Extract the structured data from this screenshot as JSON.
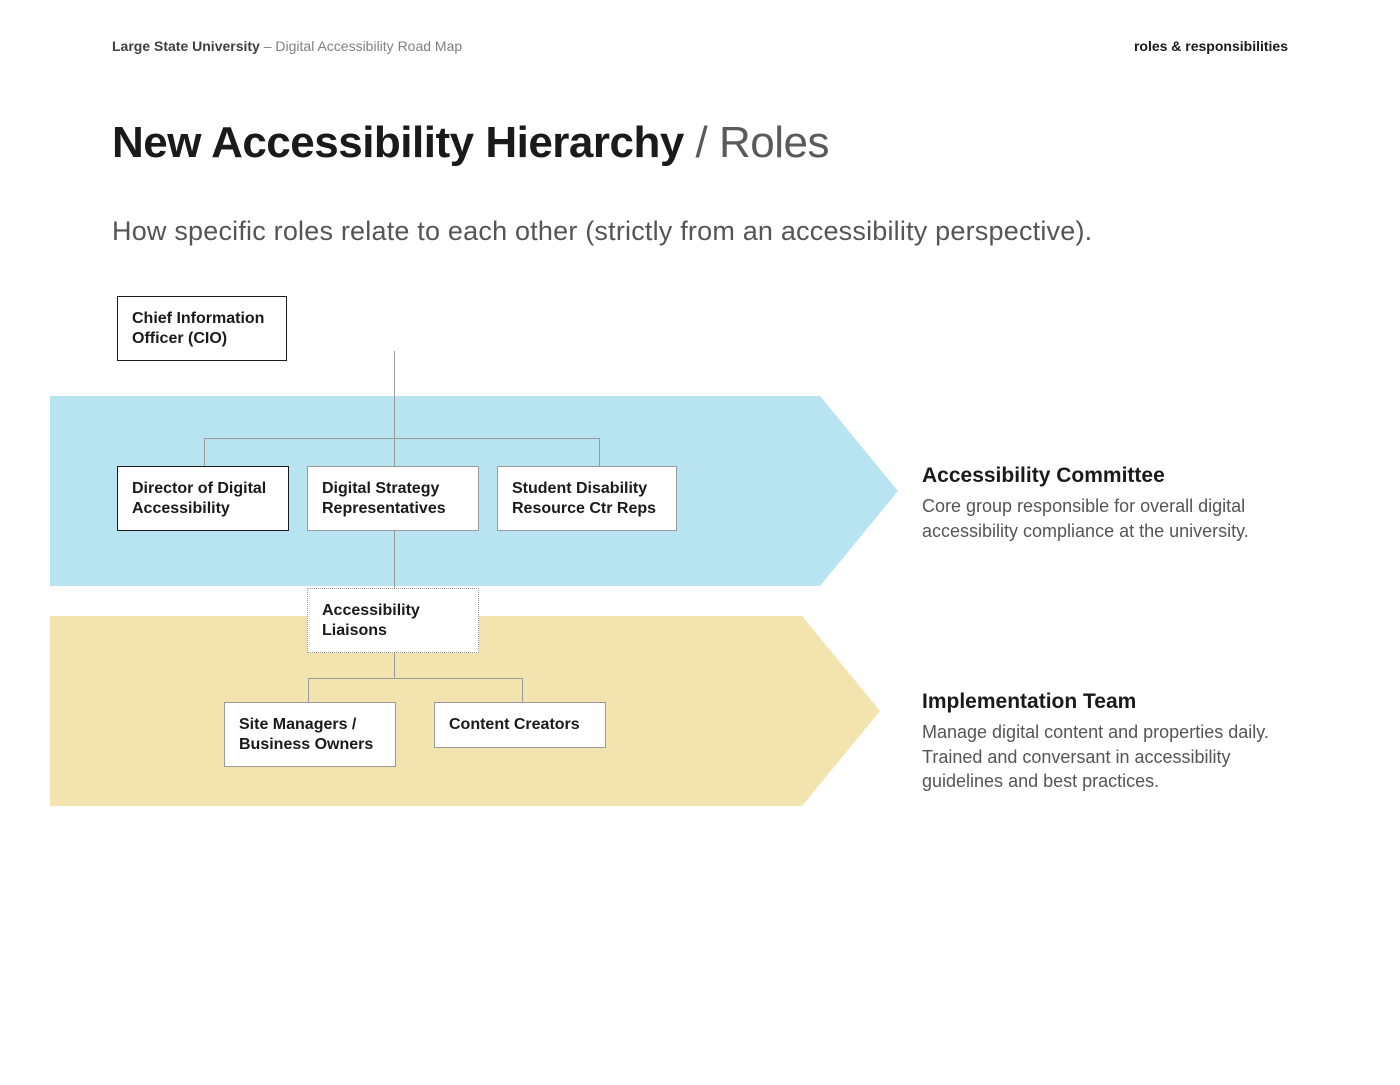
{
  "header": {
    "org": "Large State University",
    "doc": "Digital Accessibility Road Map",
    "section": "roles & responsibilities"
  },
  "title": {
    "bold": "New Accessibility Hierarchy",
    "sep": " / ",
    "thin": "Roles"
  },
  "subtitle": "How specific roles relate to each other (strictly from an accessibility perspective).",
  "nodes": {
    "cio": "Chief Information Officer (CIO)",
    "dda": "Director of Digital Accessibility",
    "dsr": "Digital Strategy Representatives",
    "sdrc": "Student Disability Resource Ctr Reps",
    "liaisons": "Accessibility Liaisons",
    "smbo": "Site Managers / Business Owners",
    "cc": "Content Creators"
  },
  "groups": {
    "committee": {
      "title": "Accessibility Committee",
      "desc": "Core group responsible for overall digital accessibility compliance at the university."
    },
    "implementation": {
      "title": "Implementation Team",
      "desc": "Manage digital content and properties daily. Trained and conversant in accessibility guidelines and best practices."
    }
  }
}
